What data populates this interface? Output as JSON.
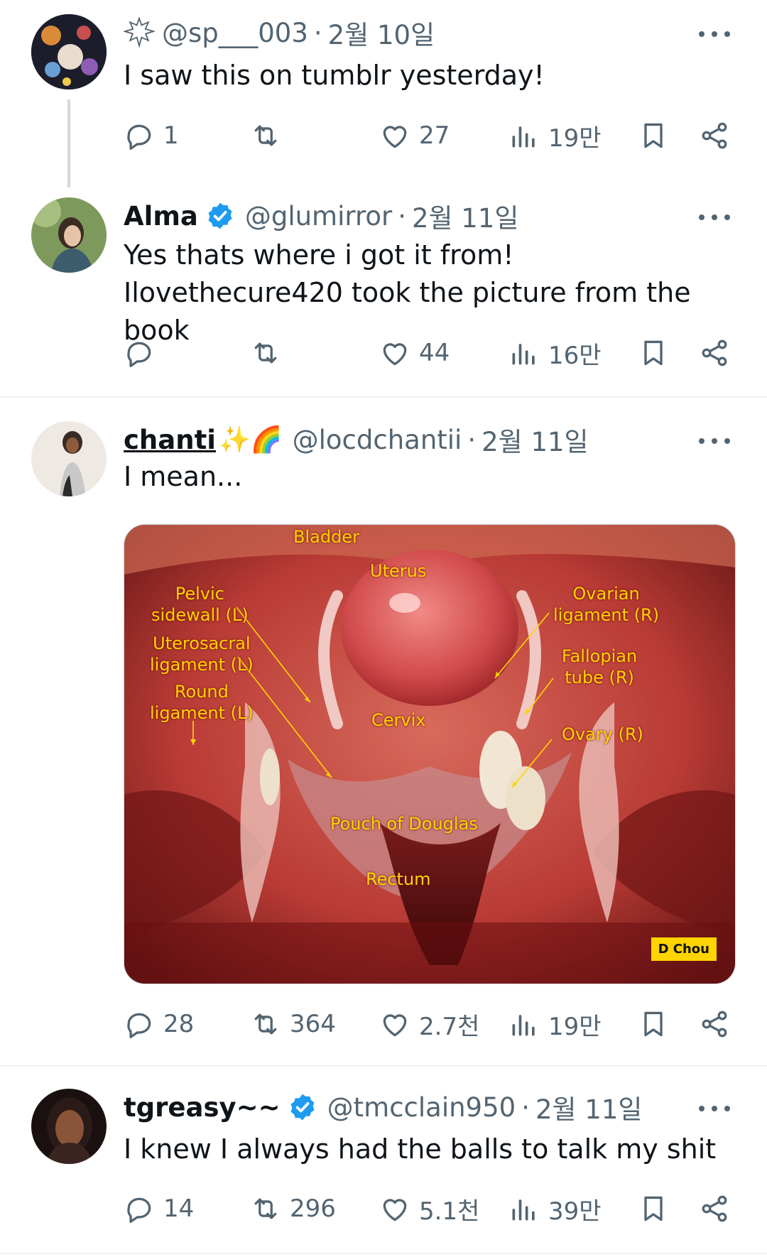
{
  "tweets": [
    {
      "handle": "@sp___003",
      "date": "2월 10일",
      "text": "I saw this on tumblr yesterday!",
      "stats": {
        "replies": "1",
        "retweets": "",
        "likes": "27",
        "views": "19만"
      }
    },
    {
      "name": "Alma",
      "handle": "@glumirror",
      "date": "2월 11일",
      "text": "Yes thats where i got it from! Ilovethecure420 took the picture from the book",
      "stats": {
        "replies": "",
        "retweets": "",
        "likes": "44",
        "views": "16만"
      }
    },
    {
      "name": "chanti",
      "emoji": "✨🌈",
      "handle": "@locdchantii",
      "date": "2월 11일",
      "text": "I mean...",
      "media": {
        "labels": {
          "bladder": "Bladder",
          "uterus": "Uterus",
          "pelvic": "Pelvic\nsidewall (L)",
          "uterosacral": "Uterosacral\nligament (L)",
          "round": "Round\nligament (L)",
          "cervix": "Cervix",
          "ovarian": "Ovarian\nligament (R)",
          "fallopian": "Fallopian\ntube (R)",
          "ovary": "Ovary (R)",
          "pouch": "Pouch of Douglas",
          "rectum": "Rectum",
          "credit": "D Chou"
        }
      },
      "stats": {
        "replies": "28",
        "retweets": "364",
        "likes": "2.7천",
        "views": "19만"
      }
    },
    {
      "name": "tgreasy~~",
      "handle": "@tmcclain950",
      "date": "2월 11일",
      "text": "I knew I always had the balls to talk my shit",
      "stats": {
        "replies": "14",
        "retweets": "296",
        "likes": "5.1천",
        "views": "39만"
      }
    }
  ],
  "sep": "·",
  "colors": {
    "text": "#0f1419",
    "muted": "#536471",
    "verified": "#1d9bf0",
    "label": "#ffd400"
  }
}
